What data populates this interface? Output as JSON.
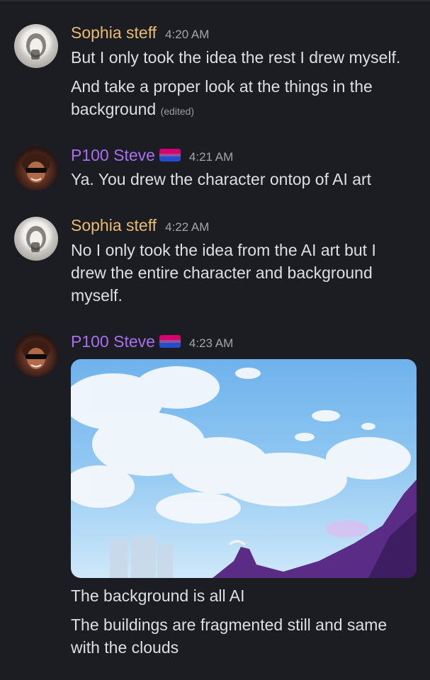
{
  "messages": [
    {
      "author": "Sophia steff",
      "time": "4:20 AM",
      "lines": [
        "But I only took the idea the rest I drew myself.",
        "And take a proper look at the things in the background"
      ],
      "edited_label": "(edited)"
    },
    {
      "author": "P100 Steve",
      "time": "4:21 AM",
      "lines": [
        "Ya. You drew the character ontop of AI art"
      ]
    },
    {
      "author": "Sophia steff",
      "time": "4:22 AM",
      "lines": [
        "No I only took the idea from the AI art but I drew the entire character and background myself."
      ]
    },
    {
      "author": "P100 Steve",
      "time": "4:23 AM",
      "lines": [
        "The background is all AI",
        "The buildings are fragmented still and same with the clouds"
      ]
    }
  ],
  "icons": {
    "flag": "bisexual-pride-flag-icon"
  },
  "colors": {
    "background": "#1c1d22",
    "sophia_name": "#e9bb72",
    "steve_name": "#a86ff0",
    "text": "#dedfe3",
    "timestamp": "#a3a5ad"
  }
}
